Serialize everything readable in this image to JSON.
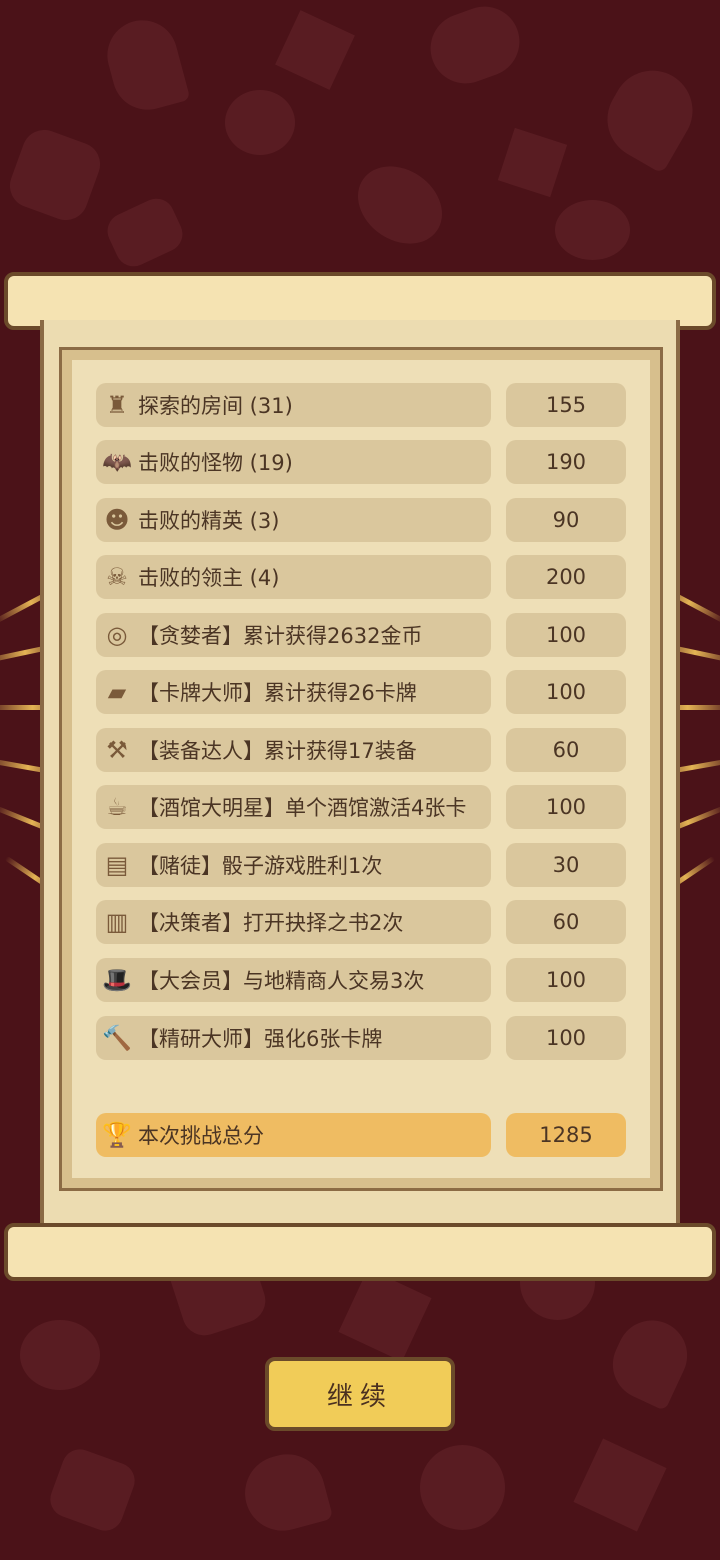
{
  "stats": [
    {
      "icon": "tower-icon",
      "label": "探索的房间 (31)",
      "score": "155"
    },
    {
      "icon": "bat-icon",
      "label": "击败的怪物 (19)",
      "score": "190"
    },
    {
      "icon": "devil-icon",
      "label": "击败的精英 (3)",
      "score": "90"
    },
    {
      "icon": "horned-skull-icon",
      "label": "击败的领主 (4)",
      "score": "200"
    },
    {
      "icon": "coins-icon",
      "label": "【贪婪者】累计获得2632金币",
      "score": "100"
    },
    {
      "icon": "cards-icon",
      "label": "【卡牌大师】累计获得26卡牌",
      "score": "100"
    },
    {
      "icon": "equipment-icon",
      "label": "【装备达人】累计获得17装备",
      "score": "60"
    },
    {
      "icon": "beer-mug-icon",
      "label": "【酒馆大明星】单个酒馆激活4张卡",
      "score": "100"
    },
    {
      "icon": "book-icon",
      "label": "【赌徒】骰子游戏胜利1次",
      "score": "30"
    },
    {
      "icon": "closed-book-icon",
      "label": "【决策者】打开抉择之书2次",
      "score": "60"
    },
    {
      "icon": "top-hat-icon",
      "label": "【大会员】与地精商人交易3次",
      "score": "100"
    },
    {
      "icon": "hammer-icon",
      "label": "【精研大师】强化6张卡牌",
      "score": "100"
    }
  ],
  "total": {
    "icon": "trophy-icon",
    "label": "本次挑战总分",
    "score": "1285"
  },
  "continue_label": "继续"
}
